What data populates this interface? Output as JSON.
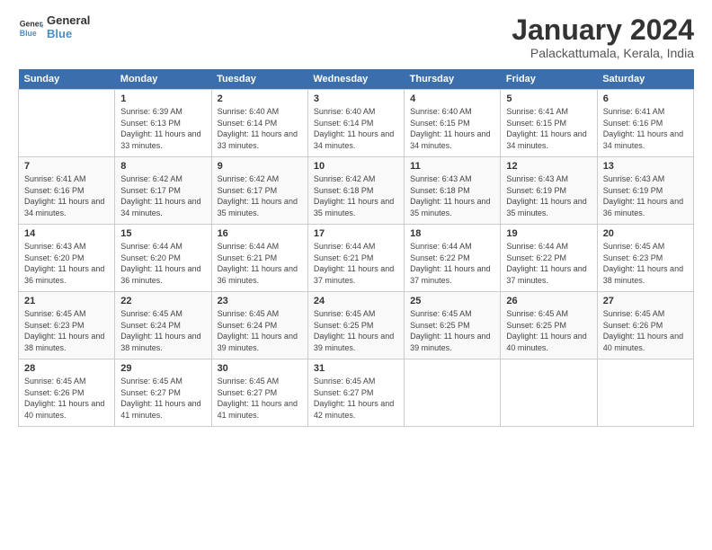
{
  "logo": {
    "line1": "General",
    "line2": "Blue"
  },
  "title": "January 2024",
  "subtitle": "Palackattumala, Kerala, India",
  "header": {
    "colors": {
      "bg": "#3a6eac"
    }
  },
  "weekdays": [
    "Sunday",
    "Monday",
    "Tuesday",
    "Wednesday",
    "Thursday",
    "Friday",
    "Saturday"
  ],
  "weeks": [
    [
      {
        "day": "",
        "sunrise": "",
        "sunset": "",
        "daylight": ""
      },
      {
        "day": "1",
        "sunrise": "Sunrise: 6:39 AM",
        "sunset": "Sunset: 6:13 PM",
        "daylight": "Daylight: 11 hours and 33 minutes."
      },
      {
        "day": "2",
        "sunrise": "Sunrise: 6:40 AM",
        "sunset": "Sunset: 6:14 PM",
        "daylight": "Daylight: 11 hours and 33 minutes."
      },
      {
        "day": "3",
        "sunrise": "Sunrise: 6:40 AM",
        "sunset": "Sunset: 6:14 PM",
        "daylight": "Daylight: 11 hours and 34 minutes."
      },
      {
        "day": "4",
        "sunrise": "Sunrise: 6:40 AM",
        "sunset": "Sunset: 6:15 PM",
        "daylight": "Daylight: 11 hours and 34 minutes."
      },
      {
        "day": "5",
        "sunrise": "Sunrise: 6:41 AM",
        "sunset": "Sunset: 6:15 PM",
        "daylight": "Daylight: 11 hours and 34 minutes."
      },
      {
        "day": "6",
        "sunrise": "Sunrise: 6:41 AM",
        "sunset": "Sunset: 6:16 PM",
        "daylight": "Daylight: 11 hours and 34 minutes."
      }
    ],
    [
      {
        "day": "7",
        "sunrise": "Sunrise: 6:41 AM",
        "sunset": "Sunset: 6:16 PM",
        "daylight": "Daylight: 11 hours and 34 minutes."
      },
      {
        "day": "8",
        "sunrise": "Sunrise: 6:42 AM",
        "sunset": "Sunset: 6:17 PM",
        "daylight": "Daylight: 11 hours and 34 minutes."
      },
      {
        "day": "9",
        "sunrise": "Sunrise: 6:42 AM",
        "sunset": "Sunset: 6:17 PM",
        "daylight": "Daylight: 11 hours and 35 minutes."
      },
      {
        "day": "10",
        "sunrise": "Sunrise: 6:42 AM",
        "sunset": "Sunset: 6:18 PM",
        "daylight": "Daylight: 11 hours and 35 minutes."
      },
      {
        "day": "11",
        "sunrise": "Sunrise: 6:43 AM",
        "sunset": "Sunset: 6:18 PM",
        "daylight": "Daylight: 11 hours and 35 minutes."
      },
      {
        "day": "12",
        "sunrise": "Sunrise: 6:43 AM",
        "sunset": "Sunset: 6:19 PM",
        "daylight": "Daylight: 11 hours and 35 minutes."
      },
      {
        "day": "13",
        "sunrise": "Sunrise: 6:43 AM",
        "sunset": "Sunset: 6:19 PM",
        "daylight": "Daylight: 11 hours and 36 minutes."
      }
    ],
    [
      {
        "day": "14",
        "sunrise": "Sunrise: 6:43 AM",
        "sunset": "Sunset: 6:20 PM",
        "daylight": "Daylight: 11 hours and 36 minutes."
      },
      {
        "day": "15",
        "sunrise": "Sunrise: 6:44 AM",
        "sunset": "Sunset: 6:20 PM",
        "daylight": "Daylight: 11 hours and 36 minutes."
      },
      {
        "day": "16",
        "sunrise": "Sunrise: 6:44 AM",
        "sunset": "Sunset: 6:21 PM",
        "daylight": "Daylight: 11 hours and 36 minutes."
      },
      {
        "day": "17",
        "sunrise": "Sunrise: 6:44 AM",
        "sunset": "Sunset: 6:21 PM",
        "daylight": "Daylight: 11 hours and 37 minutes."
      },
      {
        "day": "18",
        "sunrise": "Sunrise: 6:44 AM",
        "sunset": "Sunset: 6:22 PM",
        "daylight": "Daylight: 11 hours and 37 minutes."
      },
      {
        "day": "19",
        "sunrise": "Sunrise: 6:44 AM",
        "sunset": "Sunset: 6:22 PM",
        "daylight": "Daylight: 11 hours and 37 minutes."
      },
      {
        "day": "20",
        "sunrise": "Sunrise: 6:45 AM",
        "sunset": "Sunset: 6:23 PM",
        "daylight": "Daylight: 11 hours and 38 minutes."
      }
    ],
    [
      {
        "day": "21",
        "sunrise": "Sunrise: 6:45 AM",
        "sunset": "Sunset: 6:23 PM",
        "daylight": "Daylight: 11 hours and 38 minutes."
      },
      {
        "day": "22",
        "sunrise": "Sunrise: 6:45 AM",
        "sunset": "Sunset: 6:24 PM",
        "daylight": "Daylight: 11 hours and 38 minutes."
      },
      {
        "day": "23",
        "sunrise": "Sunrise: 6:45 AM",
        "sunset": "Sunset: 6:24 PM",
        "daylight": "Daylight: 11 hours and 39 minutes."
      },
      {
        "day": "24",
        "sunrise": "Sunrise: 6:45 AM",
        "sunset": "Sunset: 6:25 PM",
        "daylight": "Daylight: 11 hours and 39 minutes."
      },
      {
        "day": "25",
        "sunrise": "Sunrise: 6:45 AM",
        "sunset": "Sunset: 6:25 PM",
        "daylight": "Daylight: 11 hours and 39 minutes."
      },
      {
        "day": "26",
        "sunrise": "Sunrise: 6:45 AM",
        "sunset": "Sunset: 6:25 PM",
        "daylight": "Daylight: 11 hours and 40 minutes."
      },
      {
        "day": "27",
        "sunrise": "Sunrise: 6:45 AM",
        "sunset": "Sunset: 6:26 PM",
        "daylight": "Daylight: 11 hours and 40 minutes."
      }
    ],
    [
      {
        "day": "28",
        "sunrise": "Sunrise: 6:45 AM",
        "sunset": "Sunset: 6:26 PM",
        "daylight": "Daylight: 11 hours and 40 minutes."
      },
      {
        "day": "29",
        "sunrise": "Sunrise: 6:45 AM",
        "sunset": "Sunset: 6:27 PM",
        "daylight": "Daylight: 11 hours and 41 minutes."
      },
      {
        "day": "30",
        "sunrise": "Sunrise: 6:45 AM",
        "sunset": "Sunset: 6:27 PM",
        "daylight": "Daylight: 11 hours and 41 minutes."
      },
      {
        "day": "31",
        "sunrise": "Sunrise: 6:45 AM",
        "sunset": "Sunset: 6:27 PM",
        "daylight": "Daylight: 11 hours and 42 minutes."
      },
      {
        "day": "",
        "sunrise": "",
        "sunset": "",
        "daylight": ""
      },
      {
        "day": "",
        "sunrise": "",
        "sunset": "",
        "daylight": ""
      },
      {
        "day": "",
        "sunrise": "",
        "sunset": "",
        "daylight": ""
      }
    ]
  ]
}
